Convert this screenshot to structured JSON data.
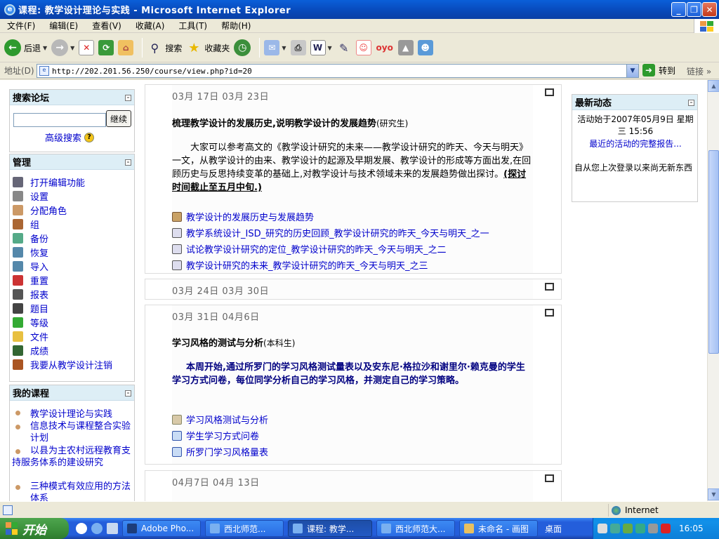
{
  "window": {
    "title": "课程: 教学设计理论与实践 - Microsoft Internet Explorer"
  },
  "menu": [
    "文件(F)",
    "编辑(E)",
    "查看(V)",
    "收藏(A)",
    "工具(T)",
    "帮助(H)"
  ],
  "toolbar": {
    "back_label": "后退",
    "search_label": "搜索",
    "favorites_label": "收藏夹"
  },
  "address": {
    "label": "地址(D)",
    "url": "http://202.201.56.250/course/view.php?id=20",
    "go_label": "转到",
    "links_label": "链接"
  },
  "left": {
    "search": {
      "title": "搜索论坛",
      "button": "继续",
      "advanced": "高级搜索"
    },
    "admin": {
      "title": "管理",
      "items": [
        {
          "label": "打开编辑功能",
          "icon": "edit-icon",
          "color": "#667"
        },
        {
          "label": "设置",
          "icon": "settings-icon",
          "color": "#888"
        },
        {
          "label": "分配角色",
          "icon": "roles-icon",
          "color": "#c96"
        },
        {
          "label": "组",
          "icon": "group-icon",
          "color": "#a63"
        },
        {
          "label": "备份",
          "icon": "backup-icon",
          "color": "#5a8"
        },
        {
          "label": "恢复",
          "icon": "restore-icon",
          "color": "#58a"
        },
        {
          "label": "导入",
          "icon": "import-icon",
          "color": "#58a"
        },
        {
          "label": "重置",
          "icon": "reset-icon",
          "color": "#c33"
        },
        {
          "label": "报表",
          "icon": "report-icon",
          "color": "#555"
        },
        {
          "label": "题目",
          "icon": "questions-icon",
          "color": "#444"
        },
        {
          "label": "等级",
          "icon": "grades-icon",
          "color": "#3a3"
        },
        {
          "label": "文件",
          "icon": "folder-icon",
          "color": "#e8c040"
        },
        {
          "label": "成绩",
          "icon": "scores-icon",
          "color": "#363"
        },
        {
          "label": "我要从教学设计注销",
          "icon": "unenrol-icon",
          "color": "#a52"
        }
      ]
    },
    "courses": {
      "title": "我的课程",
      "items": [
        "教学设计理论与实践",
        "信息技术与课程整合实验计划",
        "以县为主农村远程教育支持服务体系的建设研究",
        "三种模式有效应用的方法体系"
      ]
    }
  },
  "right": {
    "title": "最新动态",
    "since": "活动始于2007年05月9日 星期三 15:56",
    "full_report": "最近的活动的完整报告...",
    "nothing": "自从您上次登录以来尚无新东西"
  },
  "sections": [
    {
      "date": "03月 17日 03月 23日",
      "title": "梳理教学设计的发展历史,说明教学设计的发展趋势",
      "title_note": "(研究生)",
      "body": "大家可以参考高文的《教学设计研究的未来——教学设计研究的昨天、今天与明天》一文，从教学设计的由来、教学设计的起源及早期发展、教学设计的形成等方面出发,在回顾历史与反思持续变革的基础上,对教学设计与技术领域未来的发展趋势做出探讨。",
      "body_deadline": "(探讨时间截止至五月中旬.)",
      "resources": [
        "教学设计的发展历史与发展趋势",
        "教学系统设计_ISD_研究的历史回顾_教学设计研究的昨天_今天与明天_之一",
        "试论教学设计研究的定位_教学设计研究的昨天_今天与明天_之二",
        "教学设计研究的未来_教学设计研究的昨天_今天与明天_之三"
      ]
    },
    {
      "date": "03月 24日 03月 30日"
    },
    {
      "date": "03月 31日 04月6日",
      "title": "学习风格的测试与分析",
      "title_note": "(本科生)",
      "body": "本周开始,通过所罗门的学习风格测试量表以及安东尼·格拉沙和谢里尔·赖克曼的学生学习方式问卷，每位同学分析自己的学习风格，并测定自己的学习策略。",
      "resources": [
        "学习风格测试与分析",
        "学生学习方式问卷",
        "所罗门学习风格量表"
      ]
    },
    {
      "date": "04月7日 04月 13日"
    }
  ],
  "status": {
    "zone": "Internet"
  },
  "taskbar": {
    "start": "开始",
    "tasks": [
      "Adobe Pho...",
      "西北师范...",
      "课程: 教学...",
      "西北师范大...",
      "未命名 - 画图"
    ],
    "desktop": "桌面",
    "clock": "16:05"
  }
}
